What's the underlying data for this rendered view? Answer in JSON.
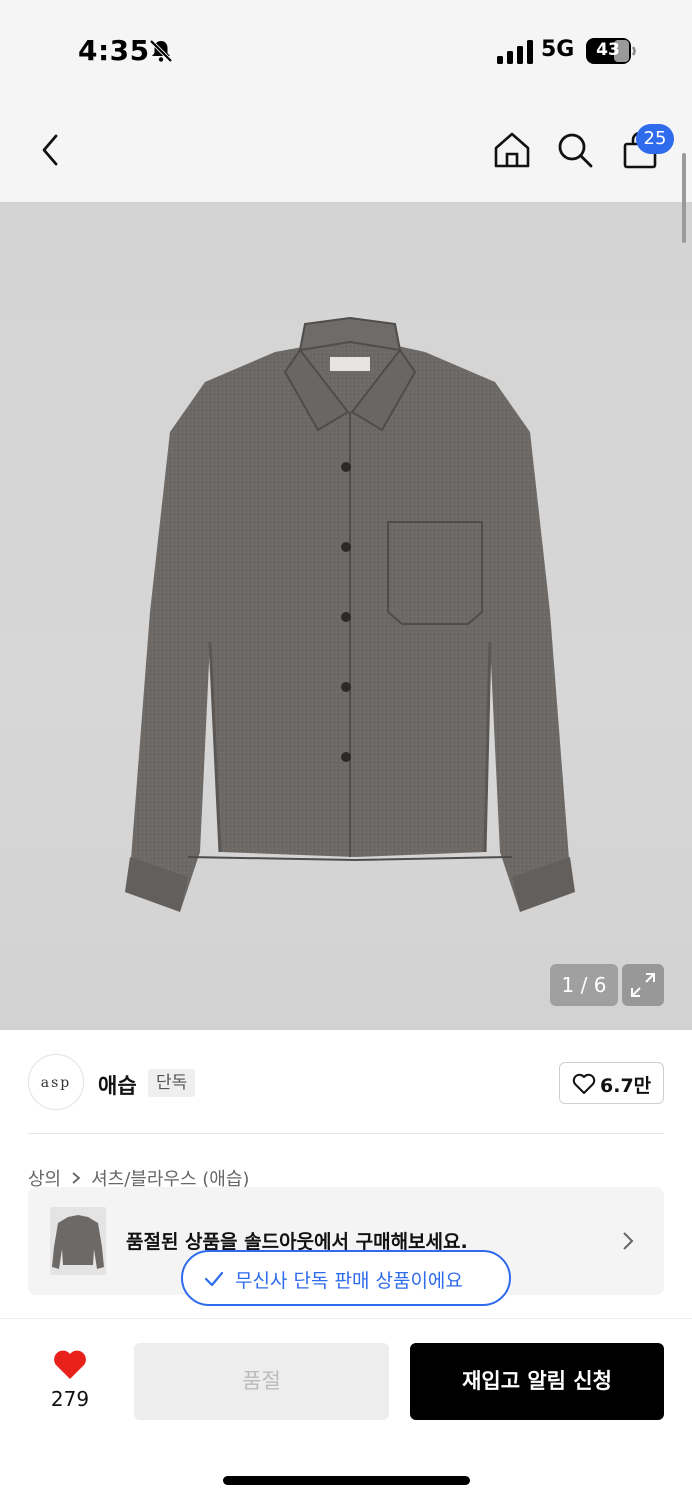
{
  "status_bar": {
    "time": "4:35",
    "network": "5G",
    "battery": "43",
    "icons": [
      "bell-slash-icon",
      "signal-bars-icon",
      "battery-icon"
    ]
  },
  "top_nav": {
    "icons": [
      "chevron-left-icon",
      "home-icon",
      "search-icon",
      "shopping-bag-icon"
    ],
    "cart_count": "25"
  },
  "product_image": {
    "page_indicator": "1 / 6",
    "expand_icon": "expand-icon"
  },
  "brand": {
    "logo_text": "asp",
    "name": "애습",
    "tag": "단독",
    "like_count": "6.7만",
    "like_icon": "heart-outline-icon"
  },
  "breadcrumb": {
    "items": [
      "상의",
      "셔츠/블라우스 (애습)"
    ],
    "separator_icon": "chevron-right-icon"
  },
  "soldout_banner": {
    "text": "품절된 상품을 솔드아웃에서 구매해보세요.",
    "chevron_icon": "chevron-right-icon"
  },
  "exclusive_pill": {
    "text": "무신사 단독 판매 상품이에요",
    "icon": "check-icon"
  },
  "bottom_bar": {
    "wishlist_count": "279",
    "soldout_label": "품절",
    "restock_label": "재입고 알림 신청",
    "heart_icon": "heart-filled-icon"
  },
  "colors": {
    "accent_blue": "#2f6bed",
    "heart_red": "#e8221b",
    "primary_black": "#000000"
  }
}
